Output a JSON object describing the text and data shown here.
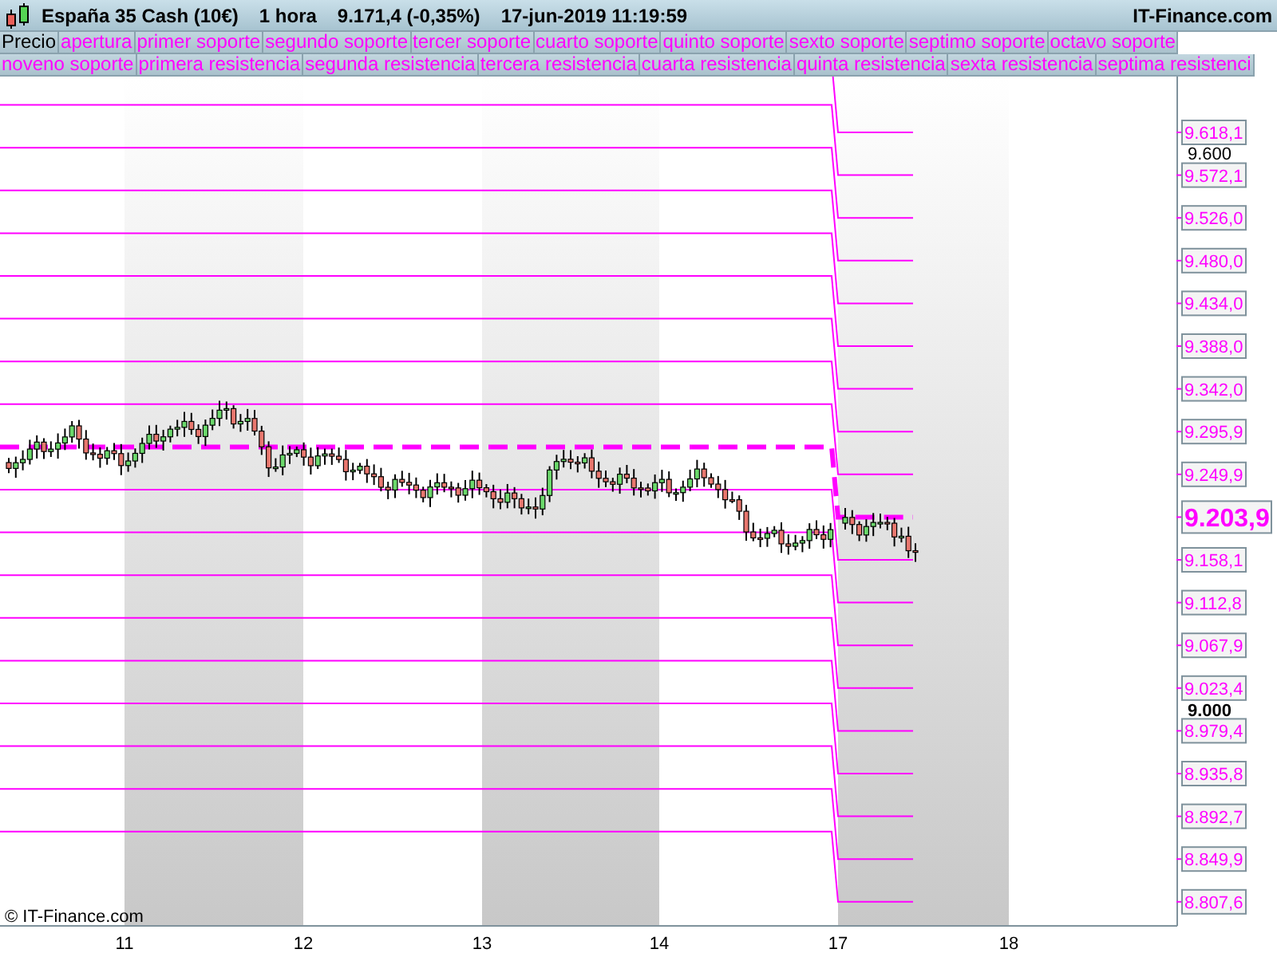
{
  "header": {
    "instrument": "España 35 Cash (10€)",
    "interval": "1 hora",
    "price": "9.171,4 (-0,35%)",
    "datetime": "17-jun-2019 11:19:59",
    "brand": "IT-Finance.com"
  },
  "legend_rows": [
    [
      {
        "label": "Precio",
        "color": "#000000"
      },
      {
        "label": "apertura",
        "color": "#ff00ff"
      },
      {
        "label": "primer soporte",
        "color": "#ff00ff"
      },
      {
        "label": "segundo soporte",
        "color": "#ff00ff"
      },
      {
        "label": "tercer soporte",
        "color": "#ff00ff"
      },
      {
        "label": "cuarto soporte",
        "color": "#ff00ff"
      },
      {
        "label": "quinto soporte",
        "color": "#ff00ff"
      },
      {
        "label": "sexto soporte",
        "color": "#ff00ff"
      },
      {
        "label": "septimo soporte",
        "color": "#ff00ff"
      },
      {
        "label": "octavo soporte",
        "color": "#ff00ff"
      }
    ],
    [
      {
        "label": "noveno soporte",
        "color": "#ff00ff"
      },
      {
        "label": "primera resistencia",
        "color": "#ff00ff"
      },
      {
        "label": "segunda resistencia",
        "color": "#ff00ff"
      },
      {
        "label": "tercera resistencia",
        "color": "#ff00ff"
      },
      {
        "label": "cuarta resistencia",
        "color": "#ff00ff"
      },
      {
        "label": "quinta resistencia",
        "color": "#ff00ff"
      },
      {
        "label": "sexta resistencia",
        "color": "#ff00ff"
      },
      {
        "label": "septima resistenci",
        "color": "#ff00ff"
      }
    ]
  ],
  "price_ticks": [
    {
      "text": "9.600",
      "bold": false
    },
    {
      "text": "9.000",
      "bold": true
    }
  ],
  "level_labels": [
    {
      "text": "9.618,1",
      "kind": "level"
    },
    {
      "text": "9.572,1",
      "kind": "level"
    },
    {
      "text": "9.526,0",
      "kind": "level"
    },
    {
      "text": "9.480,0",
      "kind": "level"
    },
    {
      "text": "9.434,0",
      "kind": "level"
    },
    {
      "text": "9.388,0",
      "kind": "level"
    },
    {
      "text": "9.342,0",
      "kind": "level"
    },
    {
      "text": "9.295,9",
      "kind": "level"
    },
    {
      "text": "9.249,9",
      "kind": "level"
    },
    {
      "text": "9.203,9",
      "kind": "current"
    },
    {
      "text": "9.158,1",
      "kind": "level"
    },
    {
      "text": "9.112,8",
      "kind": "level"
    },
    {
      "text": "9.067,9",
      "kind": "level"
    },
    {
      "text": "9.023,4",
      "kind": "level"
    },
    {
      "text": "8.979,4",
      "kind": "level"
    },
    {
      "text": "8.935,8",
      "kind": "level"
    },
    {
      "text": "8.892,7",
      "kind": "level"
    },
    {
      "text": "8.849,9",
      "kind": "level"
    },
    {
      "text": "8.807,6",
      "kind": "level"
    }
  ],
  "time_axis": [
    "11",
    "12",
    "13",
    "14",
    "17",
    "18"
  ],
  "copyright": "© IT-Finance.com"
}
